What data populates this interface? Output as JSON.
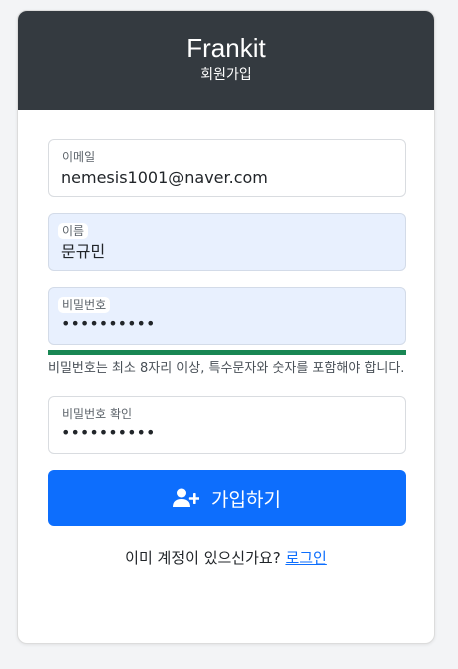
{
  "header": {
    "brand": "Frankit",
    "subtitle": "회원가입"
  },
  "form": {
    "email": {
      "label": "이메일",
      "value": "nemesis1001@naver.com"
    },
    "name": {
      "label": "이름",
      "value": "문규민"
    },
    "password": {
      "label": "비밀번호",
      "value": "••••••••••"
    },
    "password_strength": 1.0,
    "password_hint": "비밀번호는 최소 8자리 이상, 특수문자와 숫자를 포함해야 합니다.",
    "password_confirm": {
      "label": "비밀번호 확인",
      "value": "••••••••••"
    },
    "submit_label": "가입하기",
    "submit_icon": "user-plus-icon"
  },
  "footer": {
    "prompt": "이미 계정이 있으신가요?",
    "login_link": "로그인"
  },
  "colors": {
    "header_bg": "#343a40",
    "primary": "#0d6efd",
    "strength_bar": "#198754",
    "autofill_bg": "#e8f0fe"
  }
}
